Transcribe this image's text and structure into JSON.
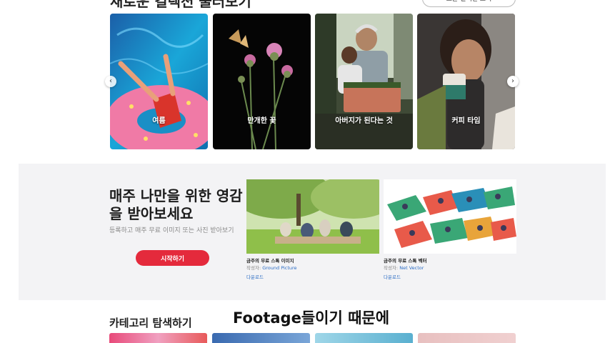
{
  "collections": {
    "title": "새로운 컬렉션 둘러보기",
    "view_all": "모든 컬렉션 보기",
    "cards": [
      {
        "label": "여름"
      },
      {
        "label": "만개한 꽃"
      },
      {
        "label": "아버지가 된다는 것"
      },
      {
        "label": "커피 타임"
      }
    ],
    "prev_icon": "chevron-left-icon",
    "next_icon": "chevron-right-icon"
  },
  "promo": {
    "title": "매주 나만을 위한 영감을 받아보세요",
    "subtitle": "등록하고 매주 무료 이미지 또는 사진 받아보기",
    "button": "시작하기",
    "items": [
      {
        "title": "금주의 무료 스톡 이미지",
        "author_label": "작성자:",
        "author": "Ground Picture",
        "download": "다운로드"
      },
      {
        "title": "금주의 무료 스톡 벡터",
        "author_label": "작성자:",
        "author": "Net Vector",
        "download": "다운로드"
      }
    ]
  },
  "categories": {
    "title": "카테고리 탐색하기"
  },
  "video_subtitle": "Footage들이기 때문에",
  "colors": {
    "accent": "#e42a3c",
    "link": "#2b6cc4",
    "promo_bg": "#f3f3f5"
  }
}
